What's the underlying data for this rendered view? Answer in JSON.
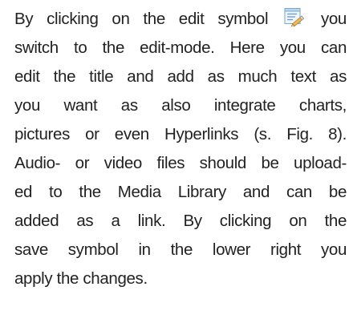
{
  "paragraph": {
    "line1_before": "By clicking on the edit symbol",
    "line1_icon": "edit-icon",
    "line1_after": "you",
    "line2": "switch to the edit-mode. Here you can",
    "line3": "edit the title and add as much text as",
    "line4": "you want as also integrate charts,",
    "line5": "pictures or even Hyperlinks (s. Fig. 8).",
    "line6": "Audio- or video files should be upload-",
    "line7": "ed to the Media Library and can be",
    "line8": "added as a link. By clicking on the",
    "line9": "save symbol in the lower right you",
    "line10": "apply the changes."
  }
}
